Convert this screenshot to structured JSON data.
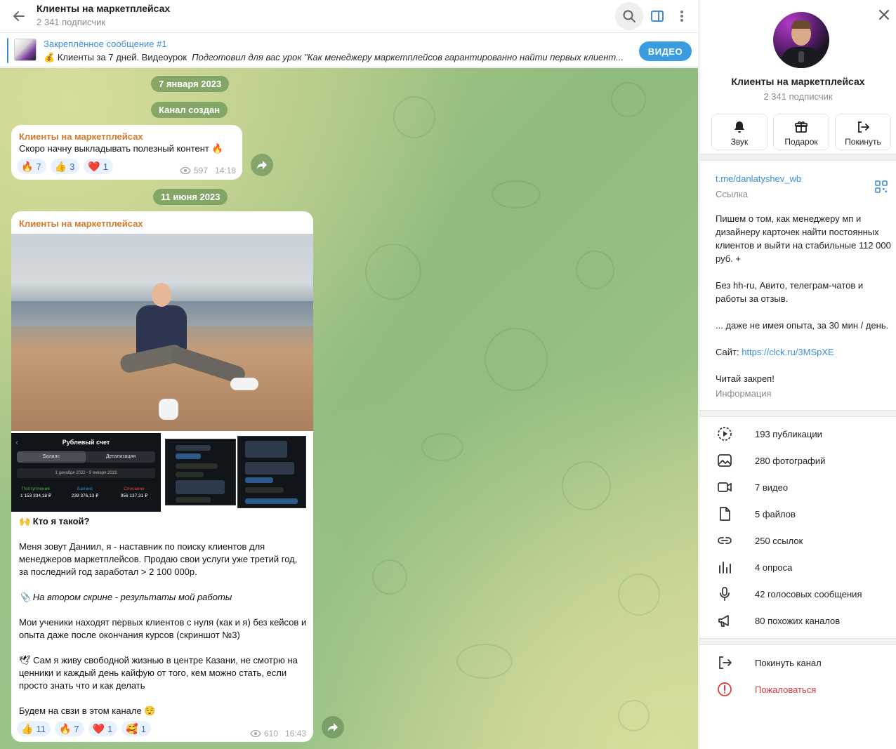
{
  "header": {
    "title": "Клиенты на маркетплейсах",
    "subscribers": "2 341 подписчик"
  },
  "pinned": {
    "title": "Закреплённое сообщение #1",
    "emoji": "💰",
    "text_plain": "Клиенты за 7 дней. Видеоурок",
    "text_italic": "Подготовил для вас урок \"Как менеджеру маркетплейсов гарантированно найти первых клиент...",
    "video_button": "ВИДЕО"
  },
  "chat": {
    "date1": "7 января 2023",
    "service1": "Канал создан",
    "date2": "11 июня 2023",
    "message1": {
      "author": "Клиенты на маркетплейсах",
      "text": "Скоро начну выкладывать полезный контент 🔥",
      "reactions": [
        {
          "emoji": "🔥",
          "count": "7"
        },
        {
          "emoji": "👍",
          "count": "3"
        },
        {
          "emoji": "❤️",
          "count": "1"
        }
      ],
      "views": "597",
      "time": "14:18"
    },
    "message2": {
      "author": "Клиенты на маркетплейсах",
      "screenshot1": {
        "title": "Рублевый счет",
        "tab_active": "Баланс",
        "tab_other": "Детализация",
        "date_range": "1 декабря 2022 - 9 января 2023",
        "income_label": "Поступления",
        "income_value": "1 153 334,18 ₽",
        "balance_label": "Баланс",
        "balance_value": "239 376,13 ₽",
        "spend_label": "Списание",
        "spend_value": "956 137,31 ₽"
      },
      "paragraphs": {
        "p1": "🙌 Кто я такой?",
        "p2": "Меня зовут Даниил, я - наставник по поиску клиентов для менеджеров маркетплейсов. Продаю свои услуги уже третий год, за последний год заработал > 2 100 000р.",
        "p3": "📎 На втором скрине - результаты мой работы",
        "p4": "Мои ученики находят первых клиентов с нуля (как и я) без кейсов и опыта даже после окончания курсов (скриншот №3)",
        "p5": "🕊 Сам я живу свободной жизнью в центре Казани, не смотрю на ценники и каждый день кайфую от того, кем можно стать, если просто знать что и как делать",
        "p6": "Будем на свзи в этом канале 😌"
      },
      "reactions": [
        {
          "emoji": "👍",
          "count": "11"
        },
        {
          "emoji": "🔥",
          "count": "7"
        },
        {
          "emoji": "❤️",
          "count": "1"
        },
        {
          "emoji": "🥰",
          "count": "1"
        }
      ],
      "views": "610",
      "time": "16:43"
    }
  },
  "info": {
    "name": "Клиенты на маркетплейсах",
    "subscribers": "2 341 подписчик",
    "actions": {
      "sound": "Звук",
      "gift": "Подарок",
      "leave": "Покинуть"
    },
    "link": "t.me/danlatyshev_wb",
    "link_label": "Ссылка",
    "description": {
      "d1": "Пишем о том, как менеджеру мп и дизайнеру карточек найти постоянных клиентов и выйти на стабильные 112 000 руб. +",
      "d2": "Без hh-ru, Авито, телеграм-чатов и работы за отзыв.",
      "d3": "... даже не имея опыта, за 30 мин / день.",
      "d4_prefix": "Сайт: ",
      "d4_link": "https://clck.ru/3MSpXE",
      "d5": "Читай закреп!"
    },
    "description_label": "Информация",
    "media": {
      "posts": "193 публикации",
      "photos": "280 фотографий",
      "videos": "7 видео",
      "files": "5 файлов",
      "links": "250 ссылок",
      "polls": "4 опроса",
      "voice": "42 голосовых сообщения",
      "similar": "80 похожих каналов"
    },
    "leave_channel": "Покинуть канал",
    "report": "Пожаловаться"
  },
  "colors": {
    "accent": "#3a8fd8",
    "author": "#d4782b",
    "danger": "#d83a3a"
  }
}
